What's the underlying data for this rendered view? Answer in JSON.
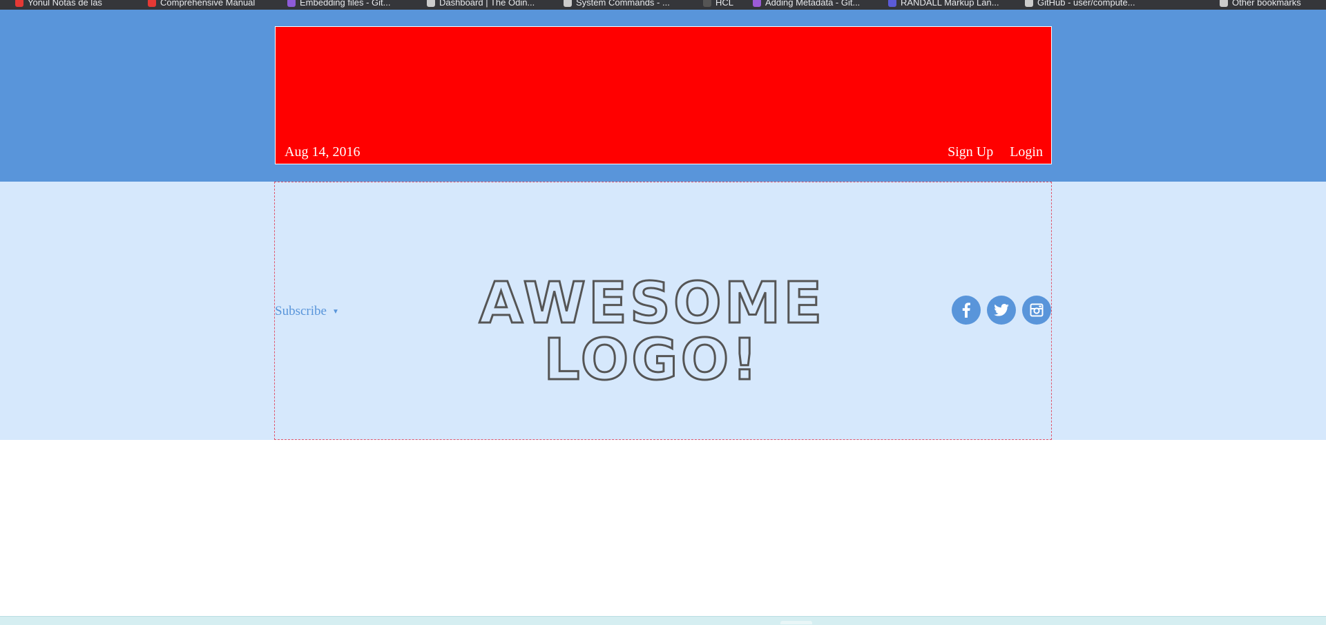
{
  "browser": {
    "bookmarks": [
      {
        "label": "Yonul Notas de las",
        "icon": "bookmark-red-icon",
        "color": "#e53935"
      },
      {
        "label": "Comprehensive Manual",
        "icon": "bookmark-red-icon",
        "color": "#e53935"
      },
      {
        "label": "Embedding files - Git...",
        "icon": "bookmark-purple-icon",
        "color": "#8e5bd8"
      },
      {
        "label": "Dashboard | The Odin...",
        "icon": "bookmark-icon",
        "color": "#cccccc"
      },
      {
        "label": "System Commands - ...",
        "icon": "bookmark-icon",
        "color": "#cccccc"
      },
      {
        "label": "HCL",
        "icon": "bookmark-dark-icon",
        "color": "#555555"
      },
      {
        "label": "Adding Metadata - Git...",
        "icon": "bookmark-icon",
        "color": "#9c5bd8"
      },
      {
        "label": "RANDALL Markup Lan...",
        "icon": "bookmark-icon",
        "color": "#5b5bd8"
      },
      {
        "label": "GitHub - user/compute...",
        "icon": "bookmark-icon",
        "color": "#cccccc"
      },
      {
        "label": "Other bookmarks",
        "icon": "folder-icon",
        "color": "#cccccc"
      }
    ]
  },
  "banner": {
    "date": "Aug 14, 2016",
    "links": [
      "Sign Up",
      "Login"
    ],
    "background": "#ff0000"
  },
  "header": {
    "subscribe_label": "Subscribe",
    "subscribe_caret": "▼",
    "logo_text": "AWESOME LOGO!",
    "social": [
      "facebook-icon",
      "twitter-icon",
      "instagram-icon"
    ]
  },
  "colors": {
    "top_band": "#5995da",
    "header_band": "#d6e8fc",
    "accent": "#5995da",
    "logo_stroke": "#555555"
  }
}
